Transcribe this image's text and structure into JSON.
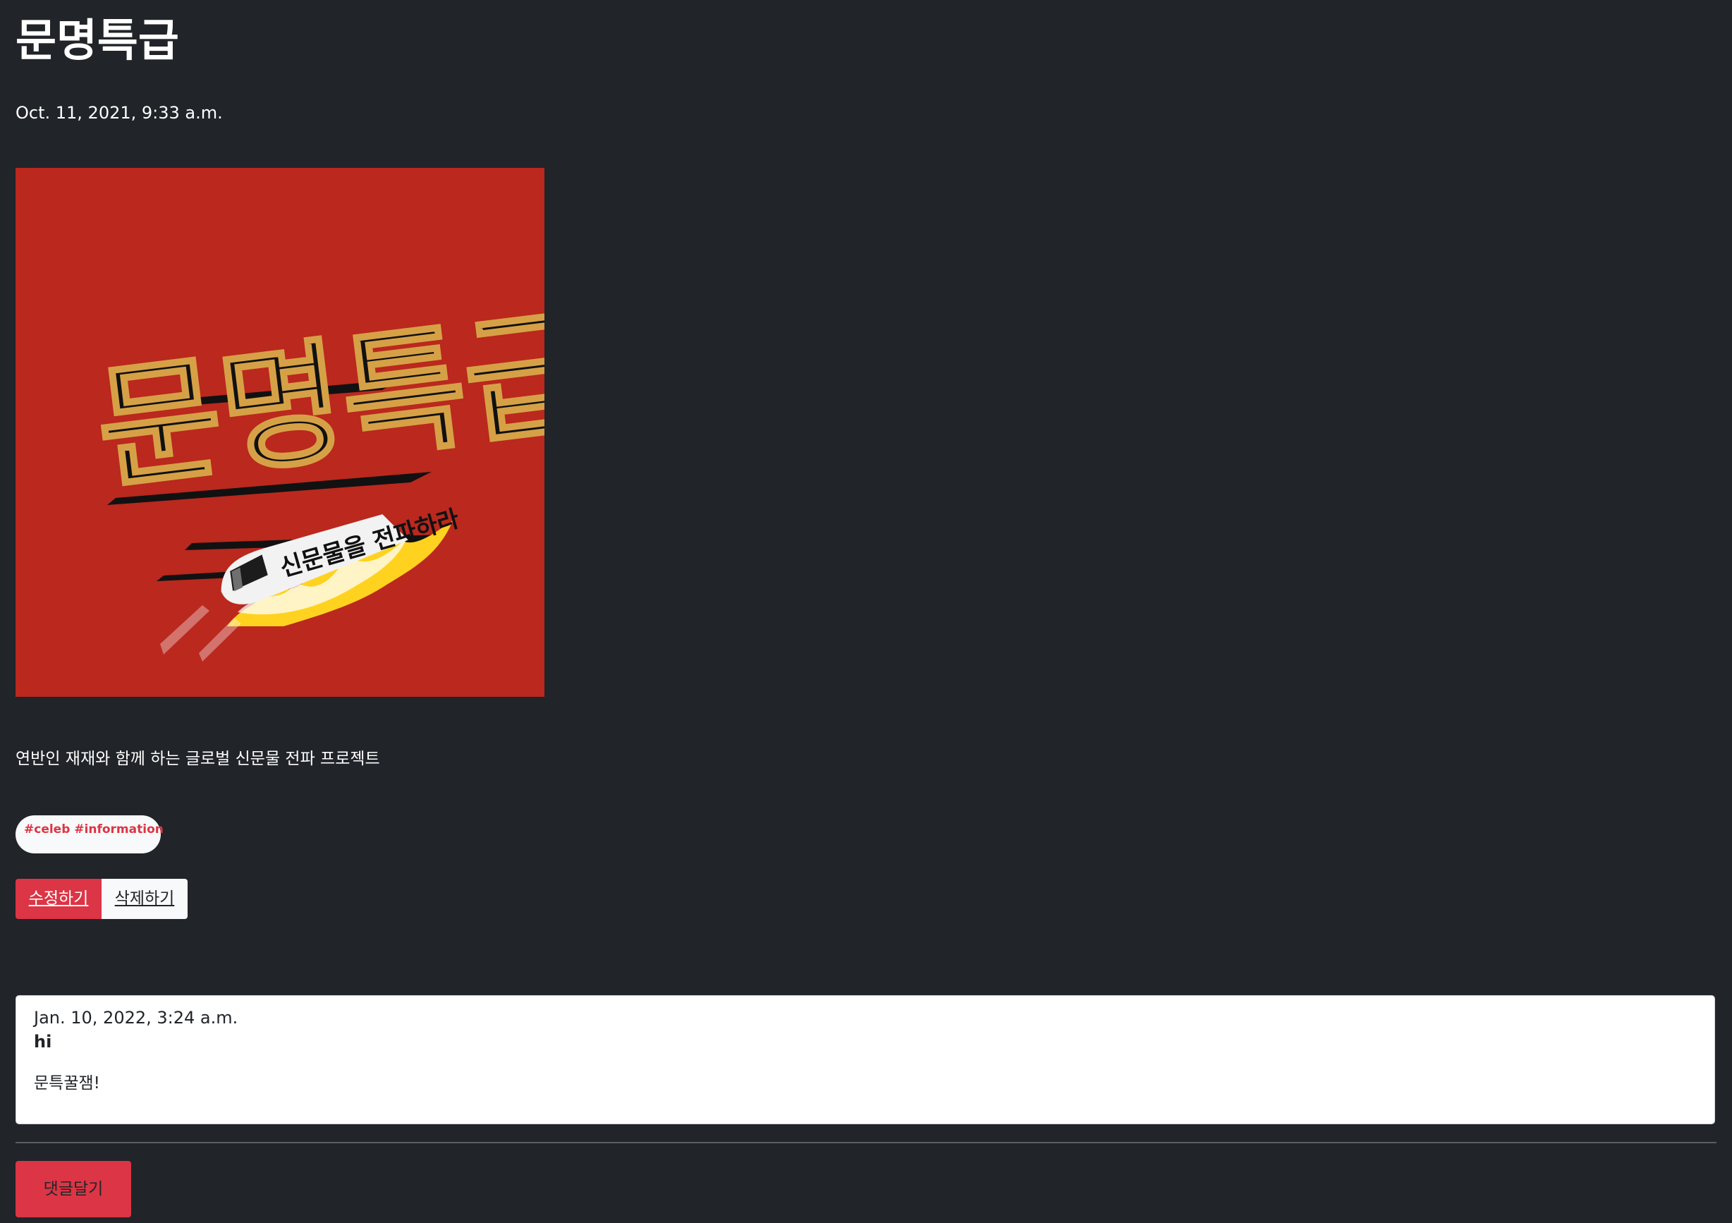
{
  "post": {
    "title": "문명특급",
    "date": "Oct. 11, 2021, 9:33 a.m.",
    "description": "연반인 재재와 함께 하는 글로벌 신문물 전파 프로젝트",
    "tags": "#celeb #information",
    "cover_image": {
      "logo_title": "문명특급",
      "logo_tagline": "신문물을 전파하라",
      "background_color": "#bf2a1f"
    }
  },
  "actions": {
    "edit_label": "수정하기",
    "delete_label": "삭제하기"
  },
  "comment": {
    "date": "Jan. 10, 2022, 3:24 a.m.",
    "author": "hi",
    "body": "문특꿀잼!"
  },
  "footer": {
    "comment_button_label": "댓글달기"
  },
  "colors": {
    "page_background": "#212429",
    "accent": "#dc3545",
    "light_surface": "#f8f9fa"
  }
}
